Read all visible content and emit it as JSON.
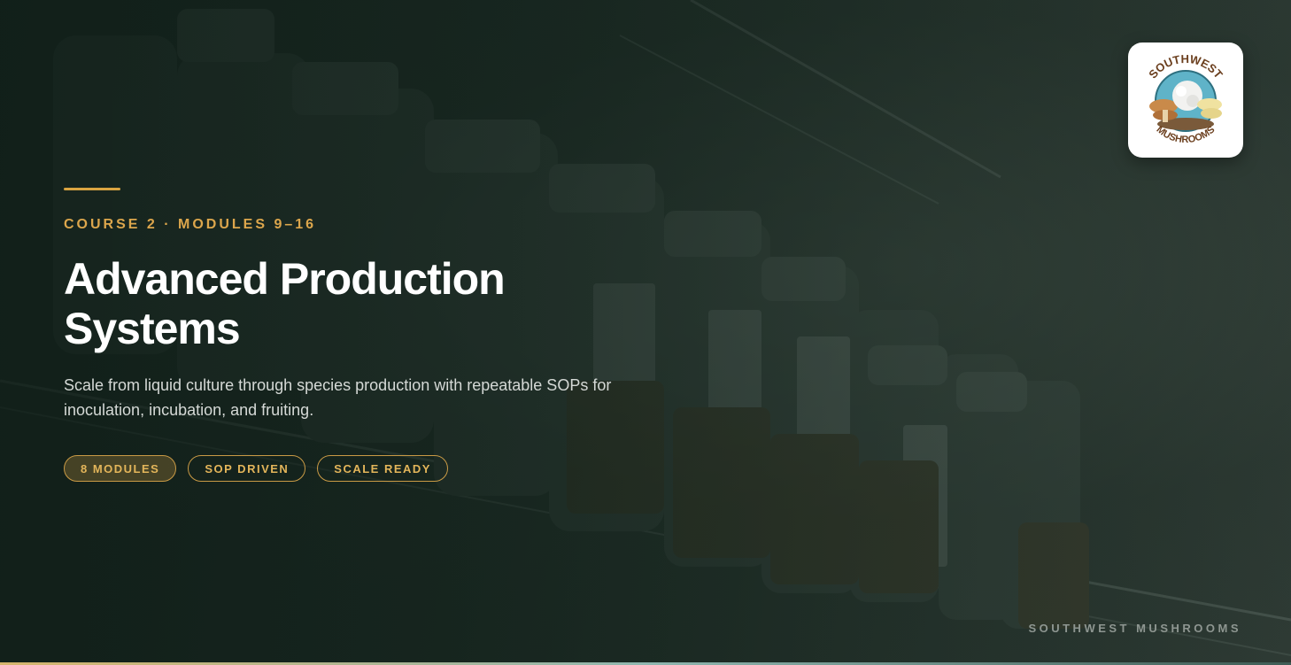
{
  "hero": {
    "eyebrow": "COURSE 2 · MODULES 9–16",
    "title": "Advanced Production Systems",
    "subtitle": "Scale from liquid culture through species production with repeatable SOPs for inoculation, incubation, and fruiting.",
    "chips": [
      {
        "label": "8 MODULES",
        "active": true
      },
      {
        "label": "SOP DRIVEN",
        "active": false
      },
      {
        "label": "SCALE READY",
        "active": false
      }
    ]
  },
  "logo": {
    "icon": "southwest-mushrooms-logo-icon",
    "top_text": "SOUTHWEST",
    "bottom_text": "MUSHROOMS"
  },
  "footer": {
    "brand": "SOUTHWEST MUSHROOMS"
  },
  "colors": {
    "accent": "#d9a441",
    "background": "#1c2a23",
    "title": "#ffffff",
    "subtitle": "#d5d9d6"
  }
}
